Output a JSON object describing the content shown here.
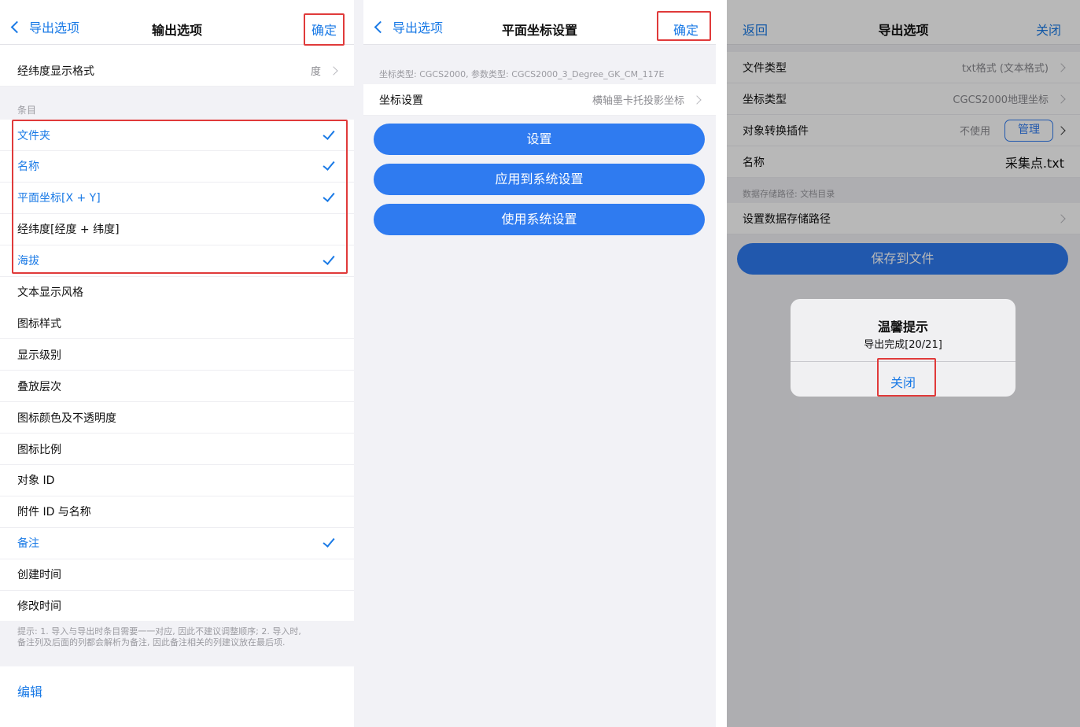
{
  "panel1": {
    "back_label": "导出选项",
    "title": "输出选项",
    "confirm_label": "确定",
    "latlon_format_label": "经纬度显示格式",
    "latlon_format_value": "度",
    "section_items": "条目",
    "items": [
      {
        "label": "文件夹",
        "checked": true
      },
      {
        "label": "名称",
        "checked": true
      },
      {
        "label": "平面坐标[X + Y]",
        "checked": true
      },
      {
        "label": "经纬度[经度 + 纬度]",
        "checked": false
      },
      {
        "label": "海拔",
        "checked": true
      },
      {
        "label": "文本显示风格",
        "checked": false
      },
      {
        "label": "图标样式",
        "checked": false
      },
      {
        "label": "显示级别",
        "checked": false
      },
      {
        "label": "叠放层次",
        "checked": false
      },
      {
        "label": "图标颜色及不透明度",
        "checked": false
      },
      {
        "label": "图标比例",
        "checked": false
      },
      {
        "label": "对象 ID",
        "checked": false
      },
      {
        "label": "附件 ID 与名称",
        "checked": false
      },
      {
        "label": "备注",
        "checked": true
      },
      {
        "label": "创建时间",
        "checked": false
      },
      {
        "label": "修改时间",
        "checked": false
      }
    ],
    "hint_line1": "提示: 1. 导入与导出时条目需要一一对应, 因此不建议调整顺序; 2. 导入时,",
    "hint_line2": "备注列及后面的列都会解析为备注, 因此备注相关的列建议放在最后项.",
    "edit_label": "编辑"
  },
  "panel2": {
    "back_label": "导出选项",
    "title": "平面坐标设置",
    "confirm_label": "确定",
    "coord_info": "坐标类型: CGCS2000, 参数类型: CGCS2000_3_Degree_GK_CM_117E",
    "coord_setting_label": "坐标设置",
    "coord_setting_value": "横轴墨卡托投影坐标",
    "btn_setup": "设置",
    "btn_apply_system": "应用到系统设置",
    "btn_use_system": "使用系统设置"
  },
  "panel3": {
    "back_label": "返回",
    "title": "导出选项",
    "close_label": "关闭",
    "file_type_label": "文件类型",
    "file_type_value": "txt格式 (文本格式)",
    "coord_type_label": "坐标类型",
    "coord_type_value": "CGCS2000地理坐标",
    "plugin_label": "对象转换插件",
    "plugin_value": "不使用",
    "plugin_manage": "管理",
    "name_label": "名称",
    "name_value": "采集点.txt",
    "storage_info": "数据存储路径: 文档目录",
    "storage_setting_label": "设置数据存储路径",
    "save_button": "保存到文件",
    "dialog_title": "温馨提示",
    "dialog_message": "导出完成[20/21]",
    "dialog_close": "关闭"
  },
  "colors": {
    "accent": "#1a7ae6",
    "button_blue": "#2f7bf0",
    "highlight_red": "#e03a3a"
  }
}
